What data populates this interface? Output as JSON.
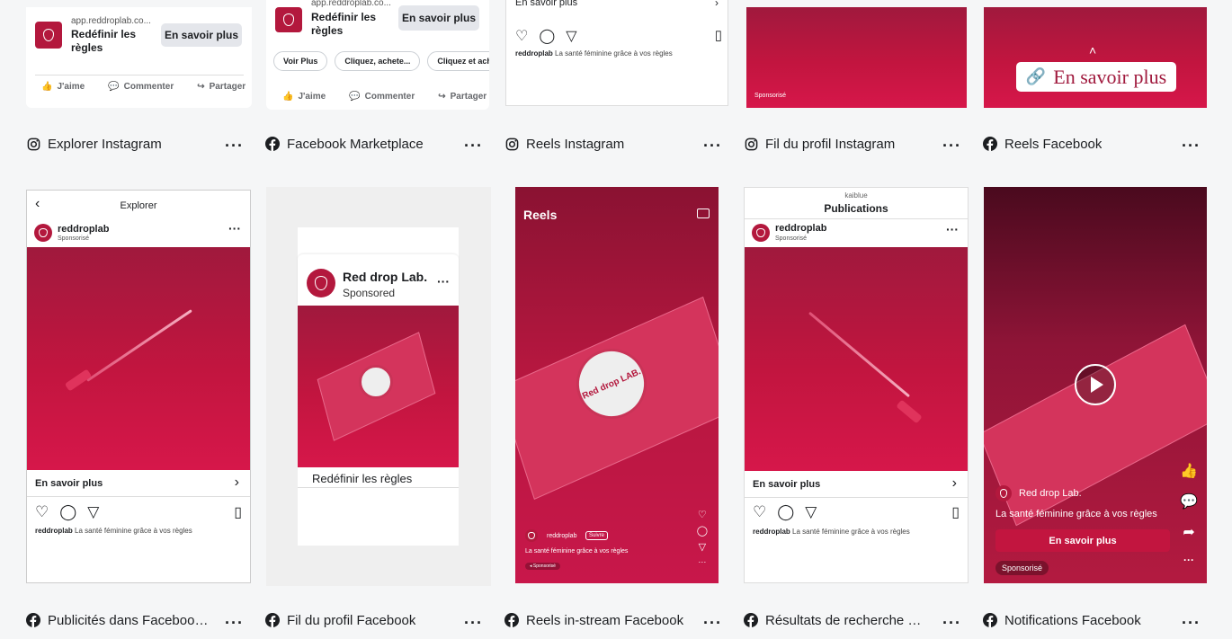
{
  "row1": [
    {
      "label": "Explorer Instagram",
      "icon": "instagram-icon",
      "url": "app.reddroplab.co...",
      "title": "Redéfinir les règles",
      "cta": "En savoir plus",
      "actions": [
        "J'aime",
        "Commenter",
        "Partager"
      ]
    },
    {
      "label": "Facebook Marketplace",
      "icon": "facebook-icon",
      "url": "app.reddroplab.co...",
      "title": "Redéfinir les règles",
      "cta": "En savoir plus",
      "pills": [
        "Voir Plus",
        "Cliquez, achete...",
        "Cliquez et ache..."
      ],
      "actions": [
        "J'aime",
        "Commenter",
        "Partager"
      ]
    },
    {
      "label": "Reels Instagram",
      "icon": "instagram-icon",
      "top_text": "En savoir plus",
      "user": "reddroplab",
      "caption": "La santé féminine grâce à vos règles"
    },
    {
      "label": "Fil du profil Instagram",
      "icon": "instagram-icon",
      "sponsored": "Sponsorisé"
    },
    {
      "label": "Reels Facebook",
      "icon": "facebook-icon",
      "cta": "En savoir plus"
    }
  ],
  "row2": [
    {
      "label": "Publicités dans Facebook ...",
      "icon": "facebook-icon",
      "header": "Explorer",
      "user": "reddroplab",
      "sponsored": "Sponsorisé",
      "cta": "En savoir plus",
      "caption_user": "reddroplab",
      "caption": "La santé féminine grâce à vos règles"
    },
    {
      "label": "Fil du profil Facebook",
      "icon": "facebook-icon",
      "page_name": "Red drop Lab.",
      "sponsored": "Sponsored",
      "title": "Redéfinir les règles"
    },
    {
      "label": "Reels in-stream Facebook",
      "icon": "facebook-icon",
      "header": "Reels",
      "user": "reddroplab",
      "follow": "Suivre",
      "caption": "La santé féminine grâce à vos règles",
      "sponsored": "Sponsorisé",
      "box_text": "Red drop LAB."
    },
    {
      "label": "Résultats de recherche Fa...",
      "icon": "facebook-icon",
      "account": "kaiblue",
      "header": "Publications",
      "user": "reddroplab",
      "sponsored": "Sponsorisé",
      "cta": "En savoir plus",
      "caption_user": "reddroplab",
      "caption": "La santé féminine grâce à vos règles"
    },
    {
      "label": "Notifications Facebook",
      "icon": "facebook-icon",
      "page_name": "Red drop Lab.",
      "caption": "La santé féminine grâce à vos règles",
      "cta": "En savoir plus",
      "sponsored": "Sponsorisé"
    }
  ],
  "colors": {
    "brand_red": "#c2153f",
    "dark_red": "#7a1030",
    "facebook_blue": "#1877f2"
  }
}
